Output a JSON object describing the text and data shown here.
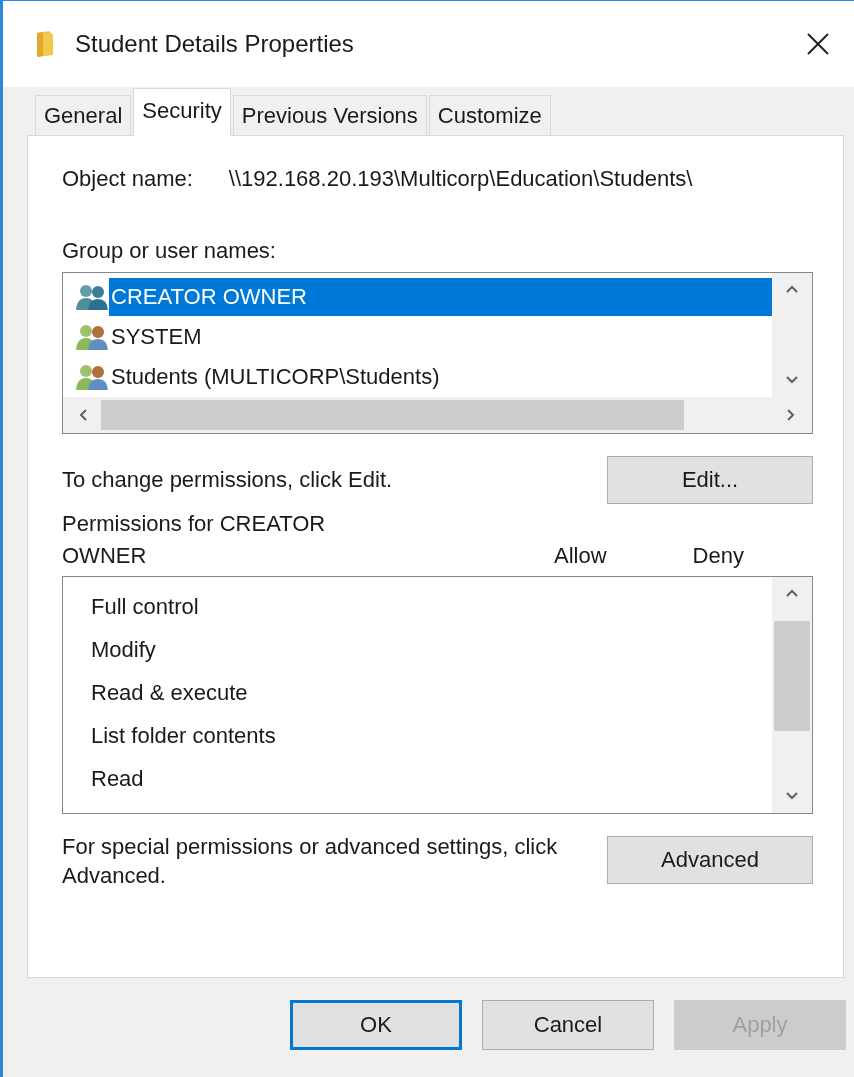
{
  "window": {
    "title": "Student Details Properties"
  },
  "tabs": [
    {
      "label": "General",
      "selected": false
    },
    {
      "label": "Security",
      "selected": true
    },
    {
      "label": "Previous Versions",
      "selected": false
    },
    {
      "label": "Customize",
      "selected": false
    }
  ],
  "object_name": {
    "label": "Object name:",
    "value": "\\\\192.168.20.193\\Multicorp\\Education\\Students\\"
  },
  "groups": {
    "label": "Group or user names:",
    "items": [
      {
        "name": "CREATOR OWNER",
        "selected": true
      },
      {
        "name": "SYSTEM",
        "selected": false
      },
      {
        "name": "Students (MULTICORP\\Students)",
        "selected": false
      }
    ]
  },
  "change_hint": "To change permissions, click Edit.",
  "edit_button": "Edit...",
  "permissions": {
    "label": "Permissions for CREATOR OWNER",
    "columns": [
      "Allow",
      "Deny"
    ],
    "items": [
      {
        "name": "Full control"
      },
      {
        "name": "Modify"
      },
      {
        "name": "Read & execute"
      },
      {
        "name": "List folder contents"
      },
      {
        "name": "Read"
      }
    ]
  },
  "advanced_hint": "For special permissions or advanced settings, click Advanced.",
  "advanced_button": "Advanced",
  "buttons": [
    {
      "label": "OK",
      "default": true,
      "disabled": false
    },
    {
      "label": "Cancel",
      "default": false,
      "disabled": false
    },
    {
      "label": "Apply",
      "default": false,
      "disabled": true
    }
  ]
}
